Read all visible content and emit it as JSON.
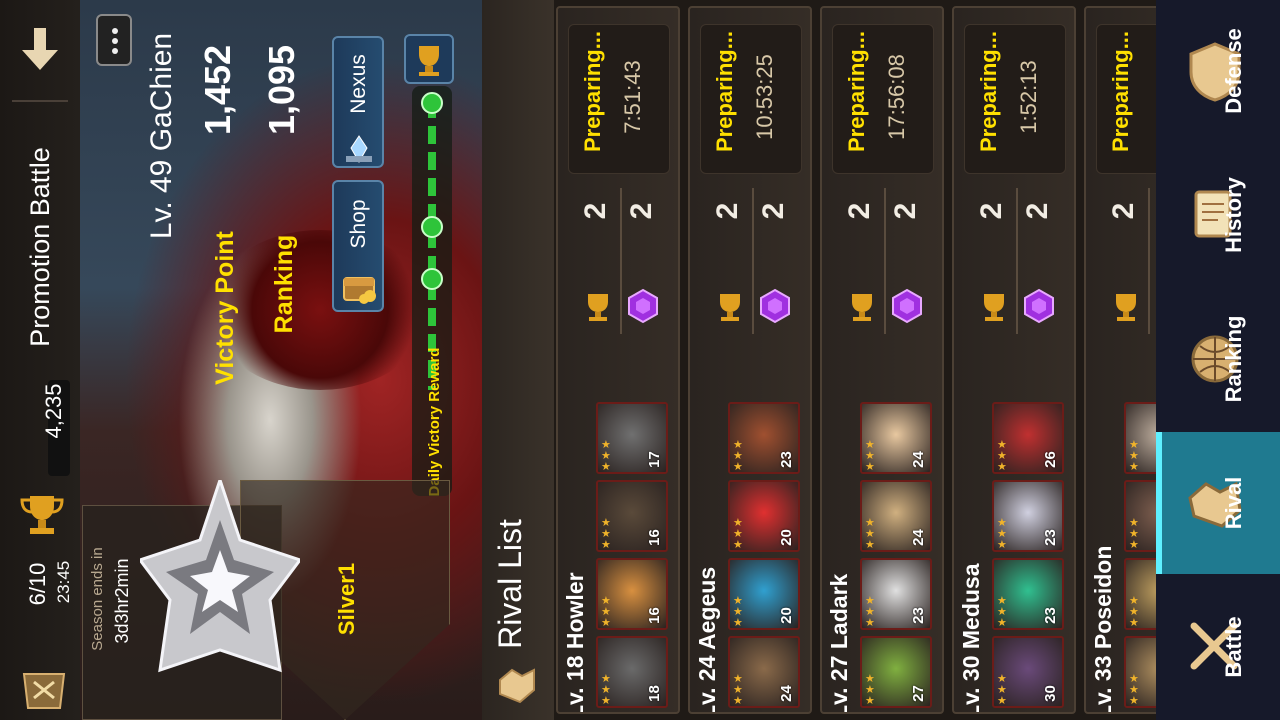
{
  "topbar": {
    "mode_title": "Promotion Battle",
    "trophy_count": "4,235",
    "battles": "6/10",
    "battle_timer": "23:45"
  },
  "player": {
    "name": "Lv. 49 GaChien",
    "victory_point_label": "Victory Point",
    "victory_point": "1,452",
    "ranking_label": "Ranking",
    "ranking": "1,095"
  },
  "season": {
    "ends_label": "Season ends in",
    "ends_value": "3d3hr2min",
    "tier": "Silver1"
  },
  "buttons": {
    "nexus": "Nexus",
    "shop": "Shop",
    "daily_reward": "Daily Victory Reward"
  },
  "rival_list": {
    "title": "Rival List",
    "rivals": [
      {
        "name": "Lv. 18 Howler",
        "status": "Preparing...",
        "timer": "7:51:43",
        "trophy": "2",
        "gem": "2",
        "monsters": [
          "18",
          "16",
          "16",
          "17"
        ]
      },
      {
        "name": "Lv. 24 Aegeus",
        "status": "Preparing...",
        "timer": "10:53:25",
        "trophy": "2",
        "gem": "2",
        "monsters": [
          "24",
          "20",
          "20",
          "23"
        ]
      },
      {
        "name": "Lv. 27 Ladark",
        "status": "Preparing...",
        "timer": "17:56:08",
        "trophy": "2",
        "gem": "2",
        "monsters": [
          "27",
          "23",
          "24",
          "24"
        ]
      },
      {
        "name": "Lv. 30 Medusa",
        "status": "Preparing...",
        "timer": "1:52:13",
        "trophy": "2",
        "gem": "2",
        "monsters": [
          "30",
          "23",
          "23",
          "26"
        ]
      },
      {
        "name": "Lv. 33 Poseidon",
        "status": "Preparing...",
        "timer": "",
        "trophy": "2",
        "gem": "",
        "monsters": [
          "",
          "",
          "",
          ""
        ]
      }
    ]
  },
  "nav": {
    "items": [
      "Defense",
      "History",
      "Ranking",
      "Rival",
      "Battle"
    ],
    "active": "Rival"
  },
  "colors": {
    "accent": "#1f7a90",
    "yellow_text": "#ffe000",
    "frame": "#6b1c18"
  }
}
